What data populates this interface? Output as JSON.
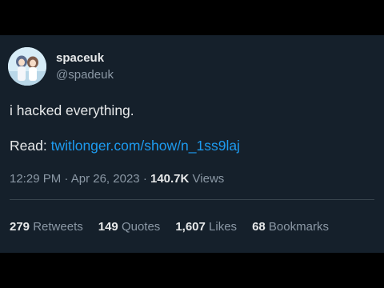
{
  "profile": {
    "display_name": "spaceuk",
    "handle": "@spadeuk",
    "avatar_icon": "anime-characters-avatar"
  },
  "tweet": {
    "text": "i hacked everything.",
    "read_label": "Read:",
    "link_text": "twitlonger.com/show/n_1ss9laj"
  },
  "meta": {
    "time": "12:29 PM",
    "separator": "·",
    "date": "Apr 26, 2023",
    "views_count": "140.7K",
    "views_label": "Views"
  },
  "stats": {
    "retweets_count": "279",
    "retweets_label": "Retweets",
    "quotes_count": "149",
    "quotes_label": "Quotes",
    "likes_count": "1,607",
    "likes_label": "Likes",
    "bookmarks_count": "68",
    "bookmarks_label": "Bookmarks"
  },
  "colors": {
    "background": "#15202b",
    "text": "#e7e9ea",
    "secondary": "#8b98a5",
    "link": "#1d9bf0",
    "letterbox": "#000000"
  }
}
